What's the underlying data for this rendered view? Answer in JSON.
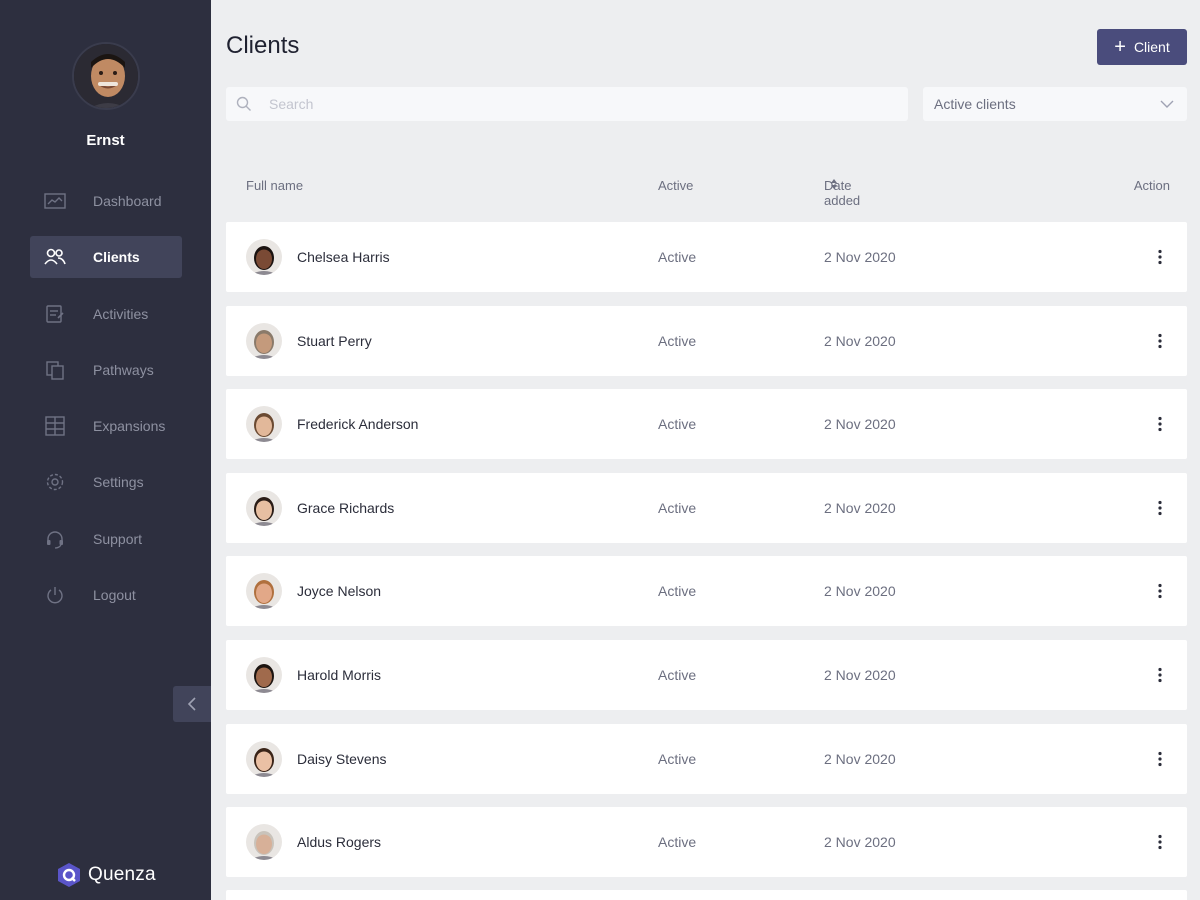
{
  "user": {
    "name": "Ernst"
  },
  "nav": [
    {
      "label": "Dashboard",
      "icon": "chart-icon",
      "active": false
    },
    {
      "label": "Clients",
      "icon": "users-icon",
      "active": true
    },
    {
      "label": "Activities",
      "icon": "clipboard-icon",
      "active": false
    },
    {
      "label": "Pathways",
      "icon": "copy-icon",
      "active": false
    },
    {
      "label": "Expansions",
      "icon": "grid-icon",
      "active": false
    },
    {
      "label": "Settings",
      "icon": "gear-icon",
      "active": false
    },
    {
      "label": "Support",
      "icon": "headset-icon",
      "active": false
    },
    {
      "label": "Logout",
      "icon": "power-icon",
      "active": false
    }
  ],
  "brand": {
    "name": "Quenza"
  },
  "header": {
    "title": "Clients",
    "add_label": "Client"
  },
  "search": {
    "placeholder": "Search",
    "value": ""
  },
  "filter": {
    "selected": "Active clients"
  },
  "table": {
    "columns": {
      "name": "Full name",
      "active": "Active",
      "date": "Date added",
      "action": "Action"
    },
    "rows": [
      {
        "name": "Chelsea Harris",
        "status": "Active",
        "date": "2 Nov 2020",
        "skin": "#7a4a35",
        "hair": "#1a1210"
      },
      {
        "name": "Stuart Perry",
        "status": "Active",
        "date": "2 Nov 2020",
        "skin": "#c49a7c",
        "hair": "#8a7a6a"
      },
      {
        "name": "Frederick Anderson",
        "status": "Active",
        "date": "2 Nov 2020",
        "skin": "#e2b89a",
        "hair": "#6b4a32"
      },
      {
        "name": "Grace Richards",
        "status": "Active",
        "date": "2 Nov 2020",
        "skin": "#e7bfa2",
        "hair": "#2a1c16"
      },
      {
        "name": "Joyce Nelson",
        "status": "Active",
        "date": "2 Nov 2020",
        "skin": "#e2a888",
        "hair": "#b0703e"
      },
      {
        "name": "Harold Morris",
        "status": "Active",
        "date": "2 Nov 2020",
        "skin": "#a06a4c",
        "hair": "#1c1410"
      },
      {
        "name": "Daisy Stevens",
        "status": "Active",
        "date": "2 Nov 2020",
        "skin": "#eac0a4",
        "hair": "#3a2418"
      },
      {
        "name": "Aldus Rogers",
        "status": "Active",
        "date": "2 Nov 2020",
        "skin": "#d7b098",
        "hair": "#c9c3bb"
      }
    ]
  },
  "colors": {
    "sidebar": "#2d2f3f",
    "accent": "#4a4c7c",
    "nav_active": "#41445a",
    "background": "#edeef0"
  }
}
